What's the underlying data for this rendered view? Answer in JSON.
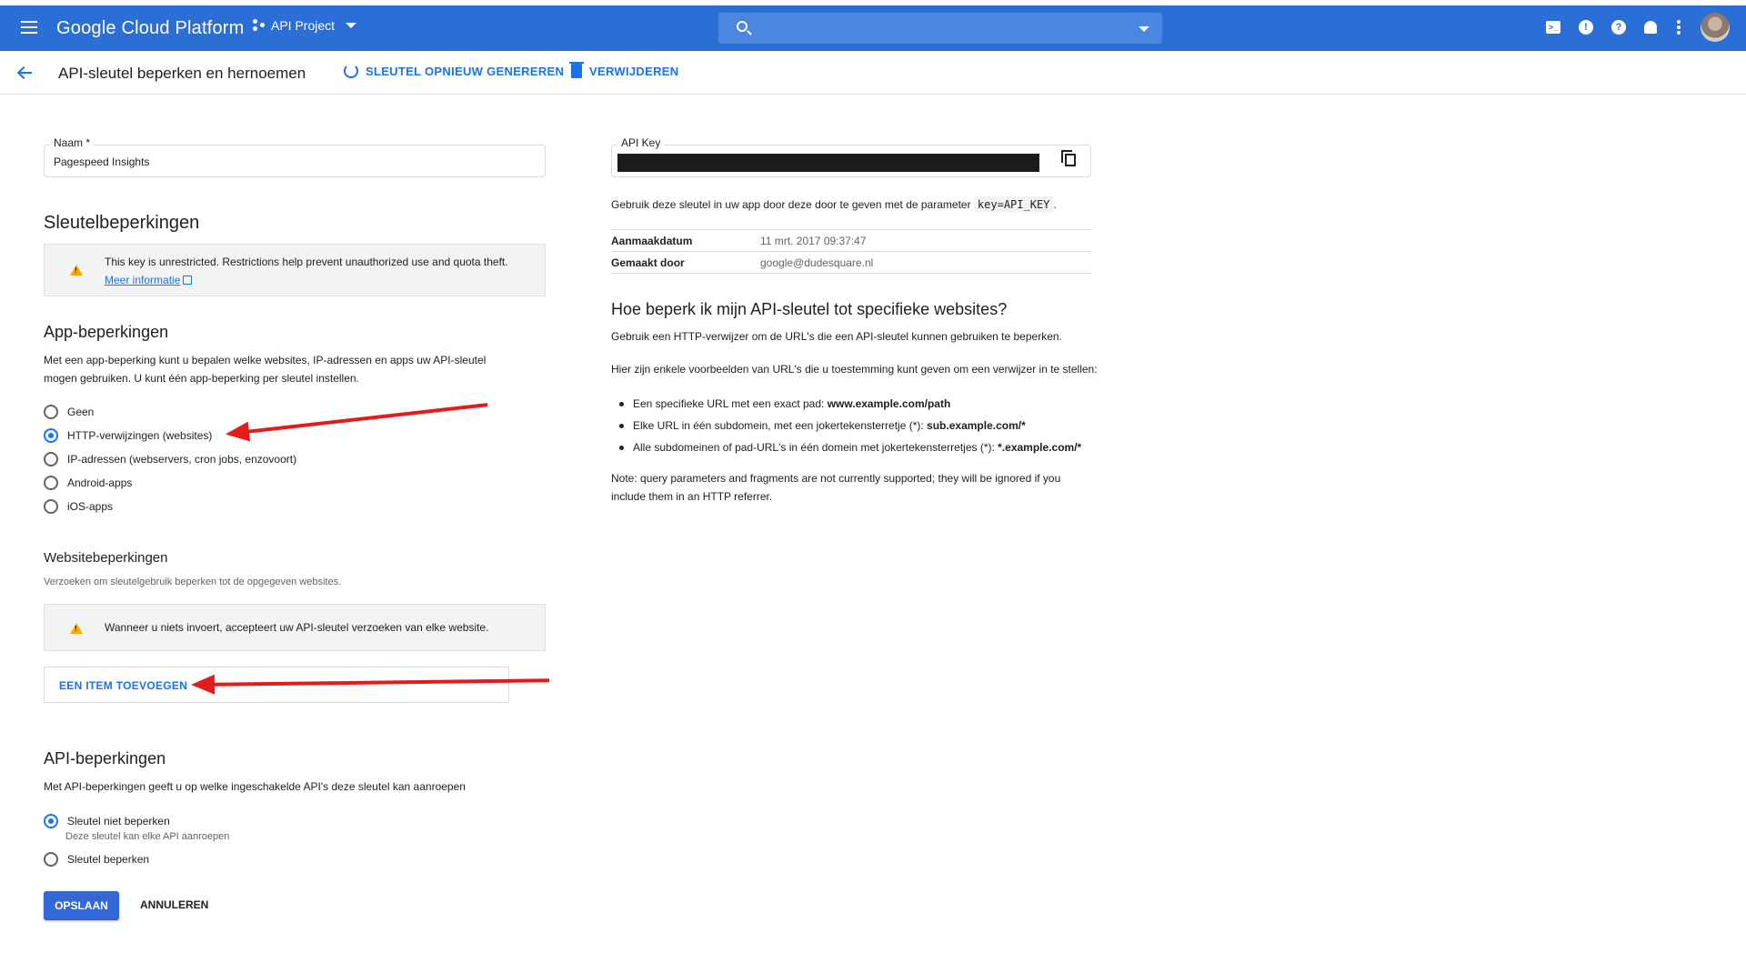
{
  "topbar": {
    "brand": "Google Cloud Platform",
    "project": "API Project",
    "search_placeholder": "",
    "color": "#2b6fd6"
  },
  "header": {
    "title": "API-sleutel beperken en hernoemen",
    "regenerate_label": "SLEUTEL OPNIEUW GENEREREN",
    "delete_label": "VERWIJDEREN"
  },
  "name_field": {
    "label": "Naam *",
    "value": "Pagespeed Insights"
  },
  "key_restrictions": {
    "heading": "Sleutelbeperkingen",
    "warning": "This key is unrestricted. Restrictions help prevent unauthorized use and quota theft.",
    "more_info_link": "Meer informatie"
  },
  "app_restrictions": {
    "heading": "App-beperkingen",
    "description": "Met een app-beperking kunt u bepalen welke websites, IP-adressen en apps uw API-sleutel mogen gebruiken. U kunt één app-beperking per sleutel instellen.",
    "options": [
      {
        "label": "Geen",
        "selected": false
      },
      {
        "label": "HTTP-verwijzingen (websites)",
        "selected": true
      },
      {
        "label": "IP-adressen (webservers, cron jobs, enzovoort)",
        "selected": false
      },
      {
        "label": "Android-apps",
        "selected": false
      },
      {
        "label": "iOS-apps",
        "selected": false
      }
    ]
  },
  "website_restrictions": {
    "heading": "Websitebeperkingen",
    "description": "Verzoeken om sleutelgebruik beperken tot de opgegeven websites.",
    "warning": "Wanneer u niets invoert, accepteert uw API-sleutel verzoeken van elke website.",
    "add_item_label": "EEN ITEM TOEVOEGEN"
  },
  "api_restrictions": {
    "heading": "API-beperkingen",
    "description": "Met API-beperkingen geeft u op welke ingeschakelde API's deze sleutel kan aanroepen",
    "options": [
      {
        "label": "Sleutel niet beperken",
        "hint": "Deze sleutel kan elke API aanroepen",
        "selected": true
      },
      {
        "label": "Sleutel beperken",
        "hint": "",
        "selected": false
      }
    ]
  },
  "actions": {
    "save_label": "OPSLAAN",
    "cancel_label": "ANNULEREN"
  },
  "api_key_panel": {
    "label": "API Key",
    "usage_prefix": "Gebruik deze sleutel in uw app door deze door te geven met de parameter",
    "usage_param": "key=API_KEY",
    "usage_suffix": ".",
    "meta": [
      {
        "key": "Aanmaakdatum",
        "value": "11 mrt. 2017 09:37:47"
      },
      {
        "key": "Gemaakt door",
        "value": "google@dudesquare.nl"
      }
    ]
  },
  "help": {
    "heading": "Hoe beperk ik mijn API-sleutel tot specifieke websites?",
    "intro": "Gebruik een HTTP-verwijzer om de URL's die een API-sleutel kunnen gebruiken te beperken.",
    "examples_intro": "Hier zijn enkele voorbeelden van URL's die u toestemming kunt geven om een verwijzer in te stellen:",
    "examples": [
      {
        "text": "Een specifieke URL met een exact pad: ",
        "bold": "www.example.com/path"
      },
      {
        "text": "Elke URL in één subdomein, met een jokertekensterretje (*): ",
        "bold": "sub.example.com/*"
      },
      {
        "text": "Alle subdomeinen of pad-URL's in één domein met jokertekensterretjes (*): ",
        "bold": "*.example.com/*"
      }
    ],
    "note": "Note: query parameters and fragments are not currently supported; they will be ignored if you include them in an HTTP referrer."
  },
  "colors": {
    "accent": "#1a73e8",
    "save_button": "#3367d6",
    "annotation_arrow": "#e31b1b",
    "warning": "#f9ab00"
  }
}
